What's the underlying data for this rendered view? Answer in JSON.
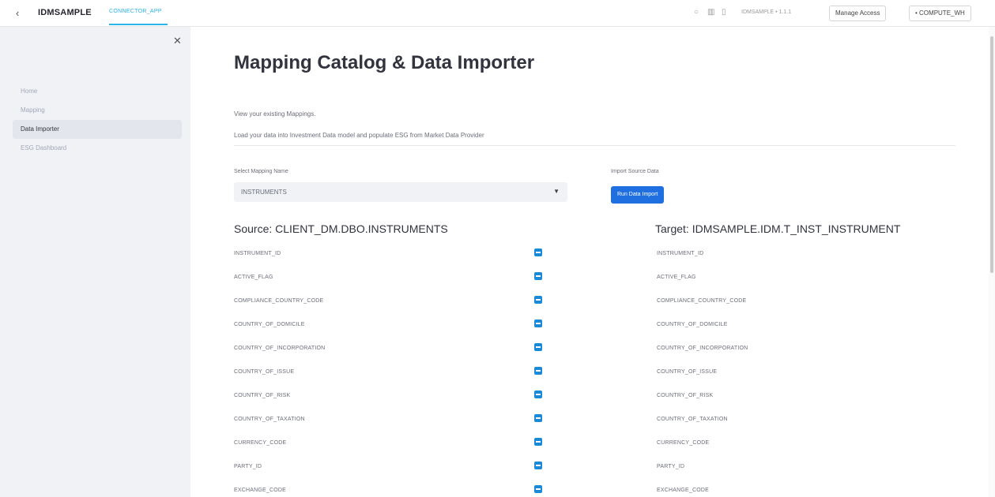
{
  "topbar": {
    "app_name": "IDMSAMPLE",
    "tab": "CONNECTOR_APP",
    "context": "IDMSAMPLE • 1.1.1",
    "manage_access": "Manage Access",
    "warehouse": "• COMPUTE_WH"
  },
  "sidebar": {
    "items": [
      {
        "label": "Home"
      },
      {
        "label": "Mapping"
      },
      {
        "label": "Data Importer"
      },
      {
        "label": "ESG Dashboard"
      }
    ]
  },
  "main": {
    "title": "Mapping Catalog & Data Importer",
    "desc1": "View your existing Mappings.",
    "desc2": "Load your data into Investment Data model and populate ESG from Market Data Provider",
    "select_label": "Select Mapping Name",
    "select_value": "INSTRUMENTS",
    "import_label": "Import Source Data",
    "run_button": "Run Data Import",
    "source_head": "Source: CLIENT_DM.DBO.INSTRUMENTS",
    "target_head": "Target: IDMSAMPLE.IDM.T_INST_INSTRUMENT",
    "rows": [
      {
        "source": "INSTRUMENT_ID",
        "target": "INSTRUMENT_ID"
      },
      {
        "source": "ACTIVE_FLAG",
        "target": "ACTIVE_FLAG"
      },
      {
        "source": "COMPLIANCE_COUNTRY_CODE",
        "target": "COMPLIANCE_COUNTRY_CODE"
      },
      {
        "source": "COUNTRY_OF_DOMICILE",
        "target": "COUNTRY_OF_DOMICILE"
      },
      {
        "source": "COUNTRY_OF_INCORPORATION",
        "target": "COUNTRY_OF_INCORPORATION"
      },
      {
        "source": "COUNTRY_OF_ISSUE",
        "target": "COUNTRY_OF_ISSUE"
      },
      {
        "source": "COUNTRY_OF_RISK",
        "target": "COUNTRY_OF_RISK"
      },
      {
        "source": "COUNTRY_OF_TAXATION",
        "target": "COUNTRY_OF_TAXATION"
      },
      {
        "source": "CURRENCY_CODE",
        "target": "CURRENCY_CODE"
      },
      {
        "source": "PARTY_ID",
        "target": "PARTY_ID"
      },
      {
        "source": "EXCHANGE_CODE",
        "target": "EXCHANGE_CODE"
      }
    ]
  },
  "colors": {
    "accent": "#29b5e8",
    "primary_button": "#1f6fe0",
    "checkbox": "#1a8ad8",
    "sidebar_bg": "#f0f2f6"
  }
}
